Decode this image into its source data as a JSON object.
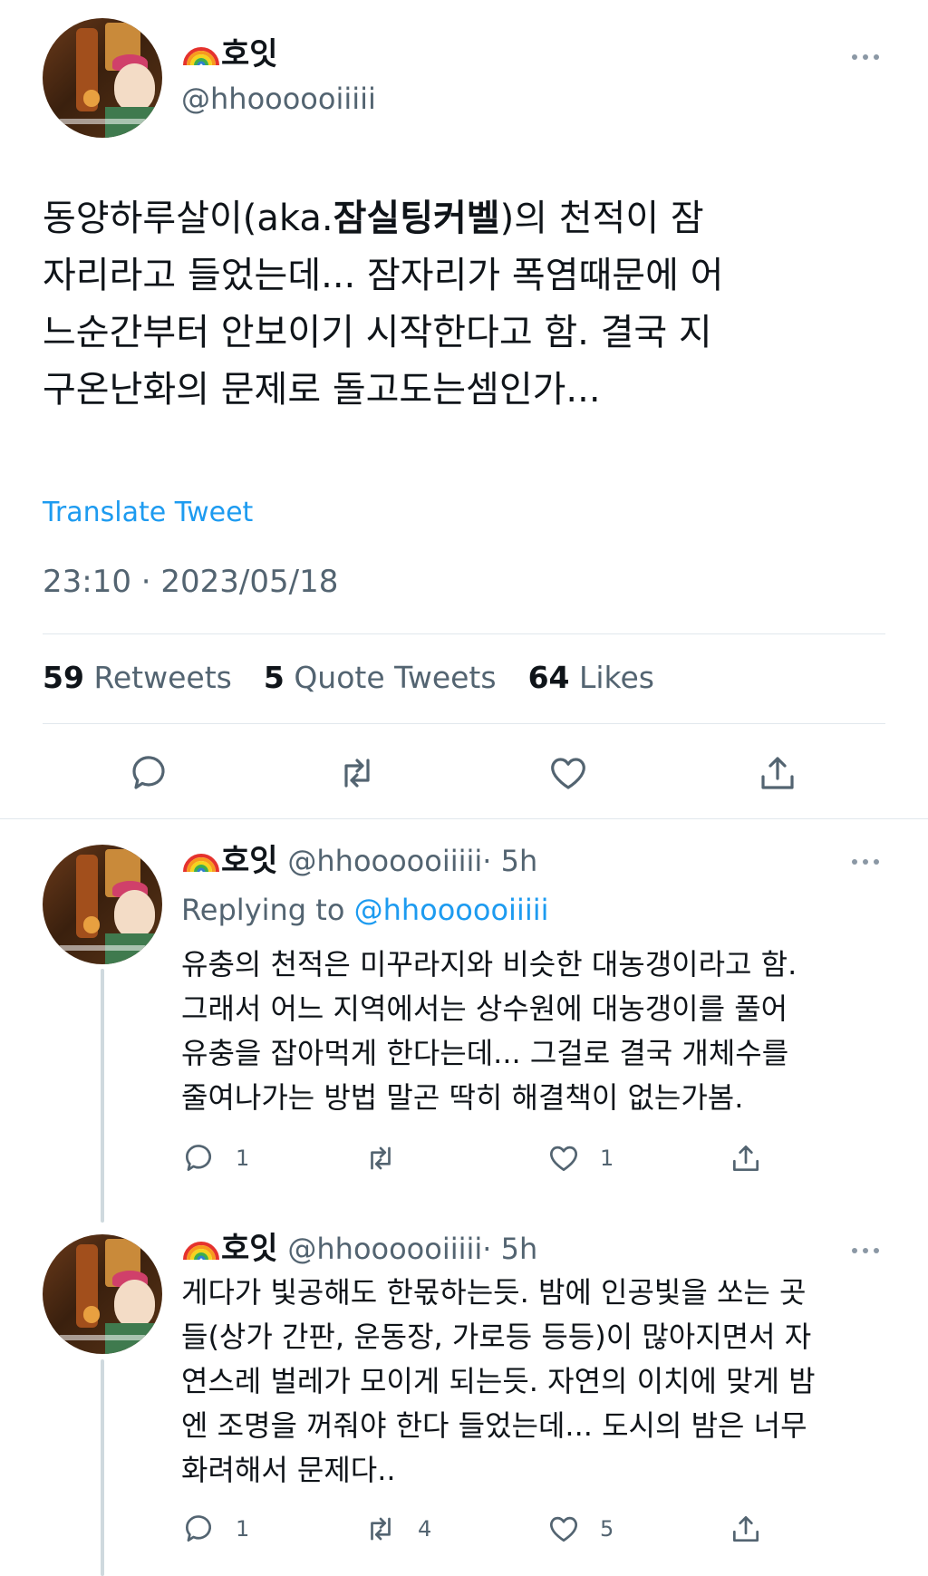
{
  "main_tweet": {
    "display_name": "호잇",
    "handle": "@hhoooooiiiii",
    "text_pre": "동양하루살이(aka.",
    "text_bold": "잠실팅커벨",
    "text_post": ")의 천적이 잠",
    "text_line2": "자리라고 들었는데... 잠자리가 폭염때문에 어",
    "text_line3": "느순간부터 안보이기 시작한다고 함. 결국 지",
    "text_line4": "구온난화의 문제로 돌고도는셈인가...",
    "translate": "Translate Tweet",
    "timestamp": "23:10 · 2023/05/18",
    "stats": {
      "retweets_count": "59",
      "retweets_label": "Retweets",
      "quotes_count": "5",
      "quotes_label": "Quote Tweets",
      "likes_count": "64",
      "likes_label": "Likes"
    }
  },
  "replies": [
    {
      "display_name": "호잇",
      "handle": "@hhoooooiiiii",
      "time": "· 5h",
      "replying_prefix": "Replying to",
      "replying_handle": "@hhoooooiiiii",
      "lines": [
        "유충의 천적은 미꾸라지와 비슷한 대농갱이라고 함.",
        "그래서 어느 지역에서는 상수원에 대농갱이를 풀어",
        "유충을 잡아먹게 한다는데... 그걸로 결국 개체수를",
        "줄여나가는 방법 말곤 딱히 해결책이 없는가봄."
      ],
      "reply_count": "1",
      "retweet_count": "",
      "like_count": "1"
    },
    {
      "display_name": "호잇",
      "handle": "@hhoooooiiiii",
      "time": "· 5h",
      "lines": [
        "게다가 빛공해도 한몫하는듯. 밤에 인공빛을 쏘는 곳",
        "들(상가 간판, 운동장, 가로등 등등)이 많아지면서 자",
        "연스레 벌레가 모이게 되는듯. 자연의 이치에 맞게 밤",
        "엔 조명을 꺼줘야 한다 들었는데... 도시의 밤은 너무",
        "화려해서 문제다.."
      ],
      "reply_count": "1",
      "retweet_count": "4",
      "like_count": "5"
    }
  ],
  "colors": {
    "text": "#0f1419",
    "secondary": "#536471",
    "link": "#1d9bf0",
    "divider": "#e1e8ed",
    "thread_line": "#cfd9de"
  },
  "icons": [
    "reply-icon",
    "retweet-icon",
    "like-icon",
    "share-icon",
    "more-icon",
    "rainbow-emoji"
  ]
}
